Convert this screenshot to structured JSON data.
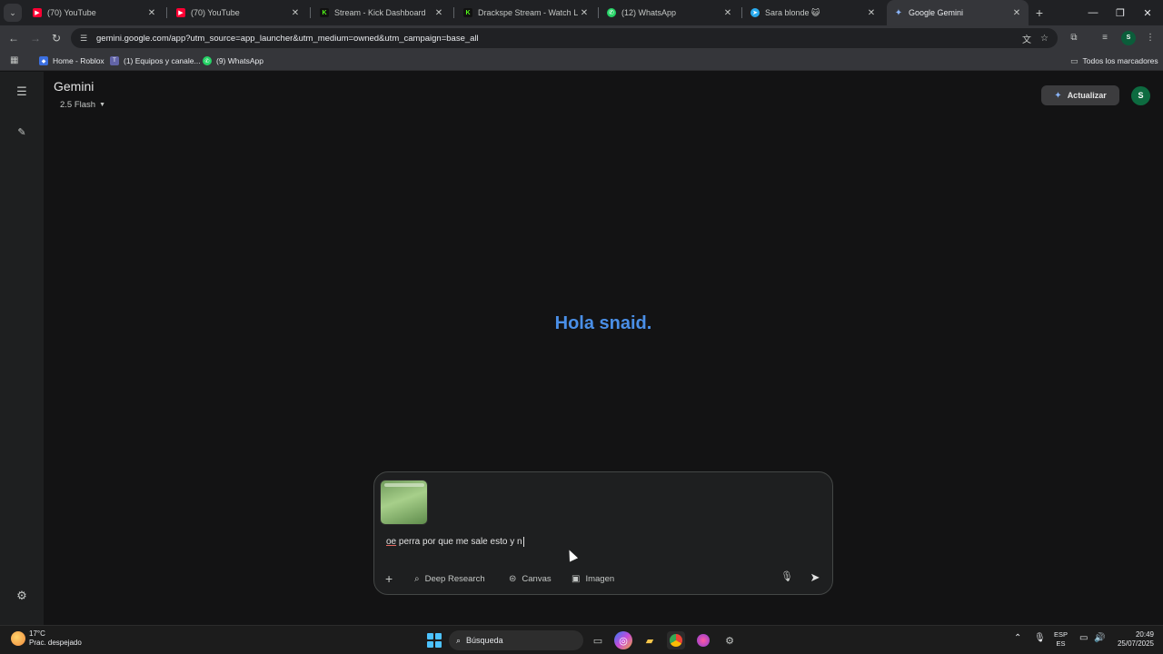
{
  "browser": {
    "tabs": [
      {
        "title": "(70) YouTube",
        "favicon": "youtube-icon",
        "color": "#ff0033"
      },
      {
        "title": "(70) YouTube",
        "favicon": "youtube-icon",
        "color": "#ff0033"
      },
      {
        "title": "Stream - Kick Dashboard",
        "favicon": "kick-icon",
        "color": "#53fc18"
      },
      {
        "title": "Drackspe Stream - Watch Live",
        "favicon": "kick-icon",
        "color": "#53fc18"
      },
      {
        "title": "(12) WhatsApp",
        "favicon": "whatsapp-icon",
        "color": "#25d366"
      },
      {
        "title": "Sara blonde 😺",
        "favicon": "telegram-icon",
        "color": "#2aabee"
      },
      {
        "title": "Google Gemini",
        "favicon": "gemini-icon",
        "color": "#8ab4f8",
        "active": true
      }
    ],
    "new_tab": "+",
    "window": {
      "minimize": "—",
      "restore": "❐",
      "close": "✕"
    },
    "url": "gemini.google.com/app?utm_source=app_launcher&utm_medium=owned&utm_campaign=base_all",
    "profile_initial": "S",
    "bookmarks": [
      {
        "label": "Home - Roblox",
        "icon": "roblox-icon",
        "color": "#3b6fe0"
      },
      {
        "label": "(1) Equipos y canale...",
        "icon": "teams-icon",
        "color": "#6264a7"
      },
      {
        "label": "(9) WhatsApp",
        "icon": "whatsapp-icon",
        "color": "#25d366"
      }
    ],
    "all_bookmarks": "Todos los marcadores"
  },
  "gemini": {
    "brand": "Gemini",
    "model": "2.5 Flash",
    "upgrade": "Actualizar",
    "avatar_initial": "S",
    "greeting": "Hola snaid.",
    "prompt": {
      "underlined": "oe",
      "rest": " perra por que me sale esto y n"
    },
    "tools": {
      "deep_research": "Deep Research",
      "canvas": "Canvas",
      "image": "Imagen"
    },
    "accent": "#4a8fe7"
  },
  "taskbar": {
    "weather_temp": "17°C",
    "weather_desc": "Prac. despejado",
    "search_placeholder": "Búsqueda",
    "lang_top": "ESP",
    "lang_bottom": "ES",
    "time": "20:49",
    "date": "25/07/2025"
  }
}
